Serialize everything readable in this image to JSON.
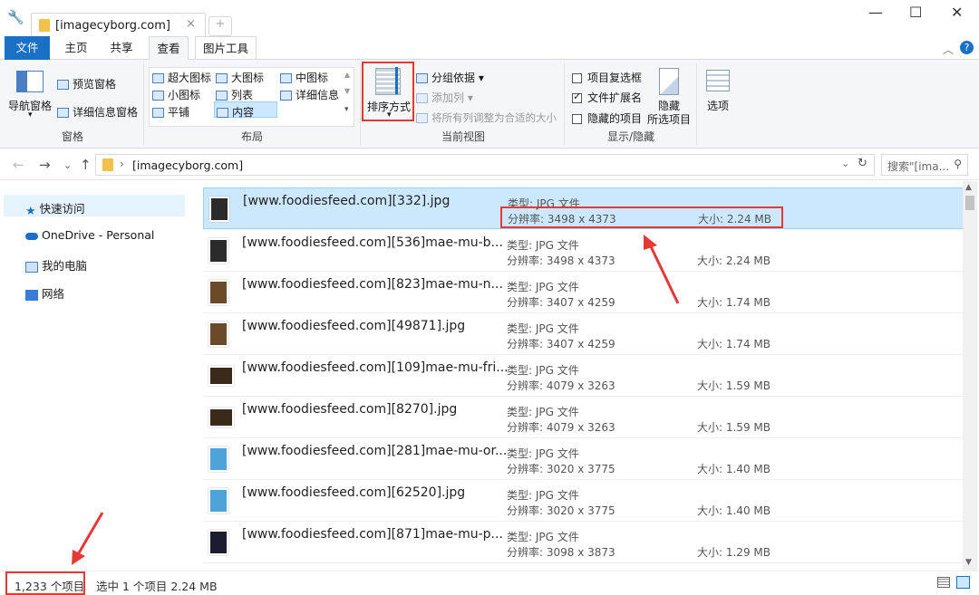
{
  "window": {
    "tab_title": "[imagecyborg.com]",
    "tab_close": "×",
    "new_tab": "+",
    "minimize": "—",
    "maximize": "☐",
    "close": "✕"
  },
  "ribbon_tabs": [
    "文件",
    "主页",
    "共享",
    "查看",
    "图片工具"
  ],
  "ribbon": {
    "panes": {
      "nav_pane": "导航窗格",
      "preview_pane": "预览窗格",
      "details_pane": "详细信息窗格",
      "group": "窗格"
    },
    "layout": {
      "items": [
        "超大图标",
        "大图标",
        "中图标",
        "小图标",
        "列表",
        "详细信息",
        "平铺",
        "内容"
      ],
      "selected": "内容",
      "group": "布局"
    },
    "current_view": {
      "sort_by": "排序方式",
      "group_by": "分组依据",
      "add_column": "添加列",
      "fit_columns": "将所有列调整为合适的大小",
      "group": "当前视图"
    },
    "show_hide": {
      "item_checkboxes": "项目复选框",
      "file_extensions": "文件扩展名",
      "hidden_items": "隐藏的项目",
      "hide_selected_1": "隐藏",
      "hide_selected_2": "所选项目",
      "group": "显示/隐藏",
      "item_checkboxes_checked": false,
      "file_extensions_checked": true,
      "hidden_items_checked": false
    },
    "options": "选项"
  },
  "address": {
    "path": "[imagecyborg.com]",
    "search_placeholder": "搜索\"[ima...",
    "refresh": "↻"
  },
  "sidebar": {
    "items": [
      {
        "label": "快速访问",
        "icon": "star-icon"
      },
      {
        "label": "OneDrive - Personal",
        "icon": "cloud-icon"
      },
      {
        "label": "我的电脑",
        "icon": "computer-icon"
      },
      {
        "label": "网络",
        "icon": "network-icon"
      }
    ]
  },
  "files": [
    {
      "name": "[www.foodiesfeed.com][332].jpg",
      "type": "类型: JPG 文件",
      "res": "分辨率: 3498 x 4373",
      "size": "大小: 2.24 MB",
      "selected": true
    },
    {
      "name": "[www.foodiesfeed.com][536]mae-mu-b...",
      "type": "类型: JPG 文件",
      "res": "分辨率: 3498 x 4373",
      "size": "大小: 2.24 MB"
    },
    {
      "name": "[www.foodiesfeed.com][823]mae-mu-n...",
      "type": "类型: JPG 文件",
      "res": "分辨率: 3407 x 4259",
      "size": "大小: 1.74 MB"
    },
    {
      "name": "[www.foodiesfeed.com][49871].jpg",
      "type": "类型: JPG 文件",
      "res": "分辨率: 3407 x 4259",
      "size": "大小: 1.74 MB"
    },
    {
      "name": "[www.foodiesfeed.com][109]mae-mu-fri...",
      "type": "类型: JPG 文件",
      "res": "分辨率: 4079 x 3263",
      "size": "大小: 1.59 MB"
    },
    {
      "name": "[www.foodiesfeed.com][8270].jpg",
      "type": "类型: JPG 文件",
      "res": "分辨率: 4079 x 3263",
      "size": "大小: 1.59 MB"
    },
    {
      "name": "[www.foodiesfeed.com][281]mae-mu-or...",
      "type": "类型: JPG 文件",
      "res": "分辨率: 3020 x 3775",
      "size": "大小: 1.40 MB"
    },
    {
      "name": "[www.foodiesfeed.com][62520].jpg",
      "type": "类型: JPG 文件",
      "res": "分辨率: 3020 x 3775",
      "size": "大小: 1.40 MB"
    },
    {
      "name": "[www.foodiesfeed.com][871]mae-mu-p...",
      "type": "类型: JPG 文件",
      "res": "分辨率: 3098 x 3873",
      "size": "大小: 1.29 MB"
    }
  ],
  "status": {
    "count": "1,233 个项目",
    "selection": "选中 1 个项目  2.24 MB"
  },
  "colors": {
    "accent": "#1a70c4",
    "selected_row": "#cce8ff",
    "highlight_box": "#e53935"
  }
}
